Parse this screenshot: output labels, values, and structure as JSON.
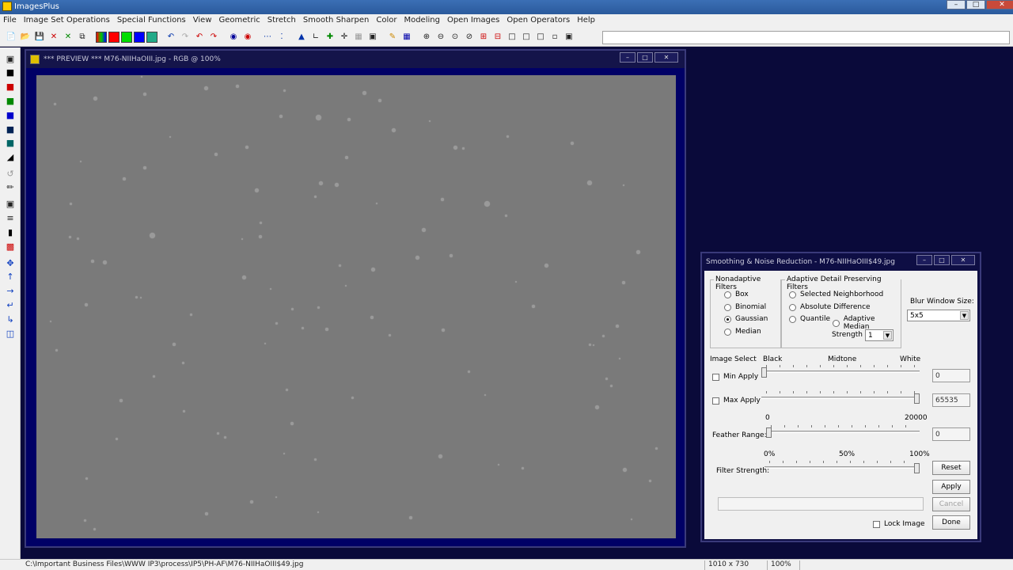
{
  "app": {
    "title": "ImagesPlus"
  },
  "menu": [
    "File",
    "Image Set Operations",
    "Special Functions",
    "View",
    "Geometric",
    "Stretch",
    "Smooth Sharpen",
    "Color",
    "Modeling",
    "Open Images",
    "Open Operators",
    "Help"
  ],
  "preview": {
    "title": "*** PREVIEW *** M76-NIIHaOIII.jpg - RGB @ 100%"
  },
  "dialog": {
    "title": "Smoothing & Noise Reduction - M76-NIIHaOIII$49.jpg",
    "nonadaptive": {
      "legend": "Nonadaptive Filters",
      "options": [
        "Box",
        "Binomial",
        "Gaussian",
        "Median"
      ],
      "selected": "Gaussian"
    },
    "adaptive": {
      "legend": "Adaptive Detail Preserving Filters",
      "selected_neighborhood": "Selected Neighborhood",
      "absolute_difference": "Absolute Difference",
      "quantile": "Quantile",
      "adaptive_median": "Adaptive Median",
      "strength_label": "Strength :",
      "strength_value": "1"
    },
    "blur": {
      "label": "Blur Window Size:",
      "value": "5x5"
    },
    "image_select": {
      "label": "Image Select",
      "black": "Black",
      "midtone": "Midtone",
      "white": "White",
      "min_apply_label": "Min Apply",
      "min_apply_value": "0",
      "min_apply_level": 0,
      "max_apply_label": "Max Apply",
      "max_apply_value": "65535",
      "max_apply_level": 1
    },
    "feather": {
      "label": "Feather Range:",
      "min": "0",
      "max": "20000",
      "value": "0",
      "level": 0
    },
    "filter_strength": {
      "label": "Filter Strength:",
      "p0": "0%",
      "p50": "50%",
      "p100": "100%",
      "level": 1
    },
    "buttons": {
      "reset": "Reset",
      "apply": "Apply",
      "cancel": "Cancel",
      "done": "Done"
    },
    "lock_image": "Lock Image"
  },
  "status": {
    "path": "C:\\Important Business Files\\WWW IP3\\process\\IP5\\PH-AF\\M76-NIIHaOIII$49.jpg",
    "dimensions": "1010 x 730",
    "zoom": "100%"
  }
}
